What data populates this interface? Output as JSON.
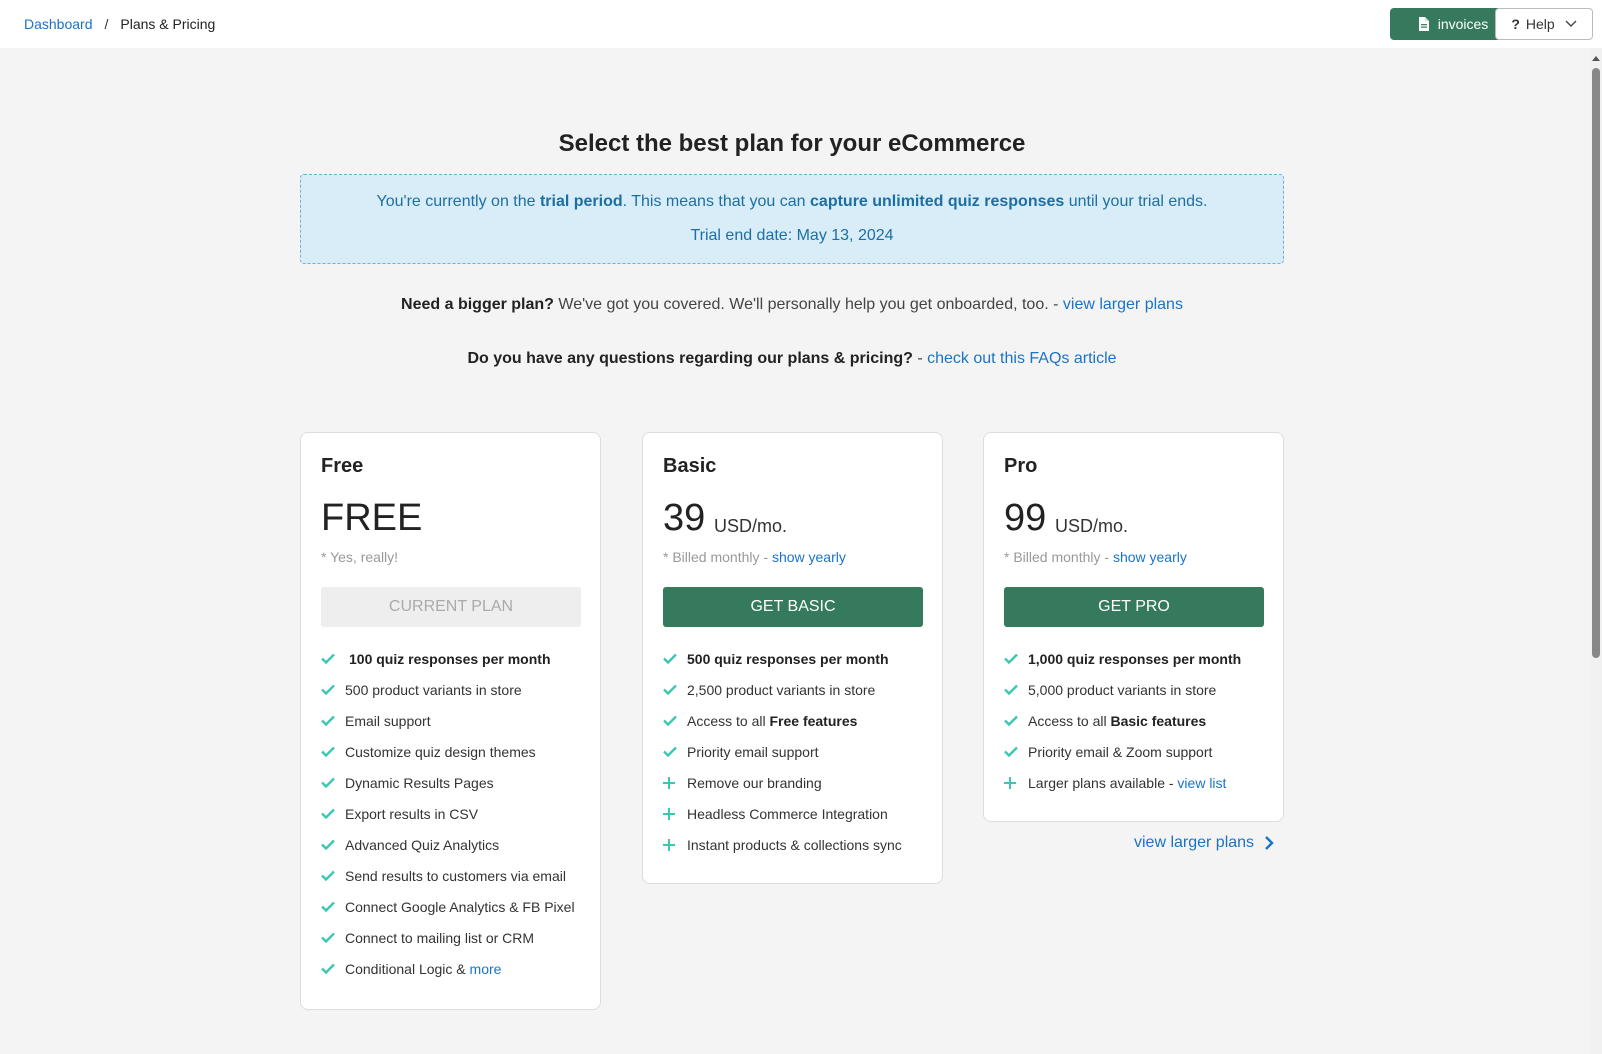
{
  "breadcrumb": {
    "parent": "Dashboard",
    "separator": "/",
    "current": "Plans & Pricing"
  },
  "header": {
    "invoices_label": "invoices",
    "help_label": "Help"
  },
  "title": "Select the best plan for your eCommerce",
  "trial": {
    "part1": "You're currently on the ",
    "bold1": "trial period",
    "part2": ". This means that you can ",
    "bold2": "capture unlimited quiz responses",
    "part3": " until your trial ends.",
    "end_date": "Trial end date: May 13, 2024"
  },
  "bigger_plan": {
    "bold": "Need a bigger plan?",
    "text": " We've got you covered. We'll personally help you get onboarded, too. - ",
    "link": "view larger plans"
  },
  "faq": {
    "bold": "Do you have any questions regarding our plans & pricing?",
    "text": " - ",
    "link": "check out this FAQs article"
  },
  "plans": {
    "free": {
      "name": "Free",
      "price": "FREE",
      "note": "* Yes, really!",
      "button": "CURRENT PLAN",
      "features": {
        "f0": "100 quiz responses per month",
        "f1": "500 product variants in store",
        "f2": "Email support",
        "f3": "Customize quiz design themes",
        "f4": "Dynamic Results Pages",
        "f5": "Export results in CSV",
        "f6": "Advanced Quiz Analytics",
        "f7": "Send results to customers via email",
        "f8": "Connect Google Analytics & FB Pixel",
        "f9": "Connect to mailing list or CRM",
        "f10_text": "Conditional Logic & ",
        "f10_link": "more"
      }
    },
    "basic": {
      "name": "Basic",
      "price": "39",
      "unit": "USD/mo.",
      "note": "* Billed monthly - ",
      "note_link": "show yearly",
      "button": "GET BASIC",
      "features": {
        "f0": "500 quiz responses per month",
        "f1": "2,500 product variants in store",
        "f2_text": "Access to all ",
        "f2_bold": "Free features",
        "f3": "Priority email support",
        "f4": "Remove our branding",
        "f5": "Headless Commerce Integration",
        "f6": "Instant products & collections sync"
      }
    },
    "pro": {
      "name": "Pro",
      "price": "99",
      "unit": "USD/mo.",
      "note": "* Billed monthly - ",
      "note_link": "show yearly",
      "button": "GET PRO",
      "features": {
        "f0": "1,000 quiz responses per month",
        "f1": "5,000 product variants in store",
        "f2_text": "Access to all ",
        "f2_bold": "Basic features",
        "f3": "Priority email & Zoom support",
        "f4_text": "Larger plans available - ",
        "f4_link": "view list"
      }
    }
  },
  "larger_plans_link": "view larger plans",
  "icons": {
    "check": "check-icon",
    "plus": "plus-icon",
    "document": "document-icon",
    "question": "question-icon",
    "chevron_down": "chevron-down-icon",
    "chevron_right": "chevron-right-icon"
  },
  "colors": {
    "accent": "#357a5c",
    "link": "#1a73c9",
    "check": "#3cc7b0",
    "trial_bg": "#d9edf9"
  }
}
